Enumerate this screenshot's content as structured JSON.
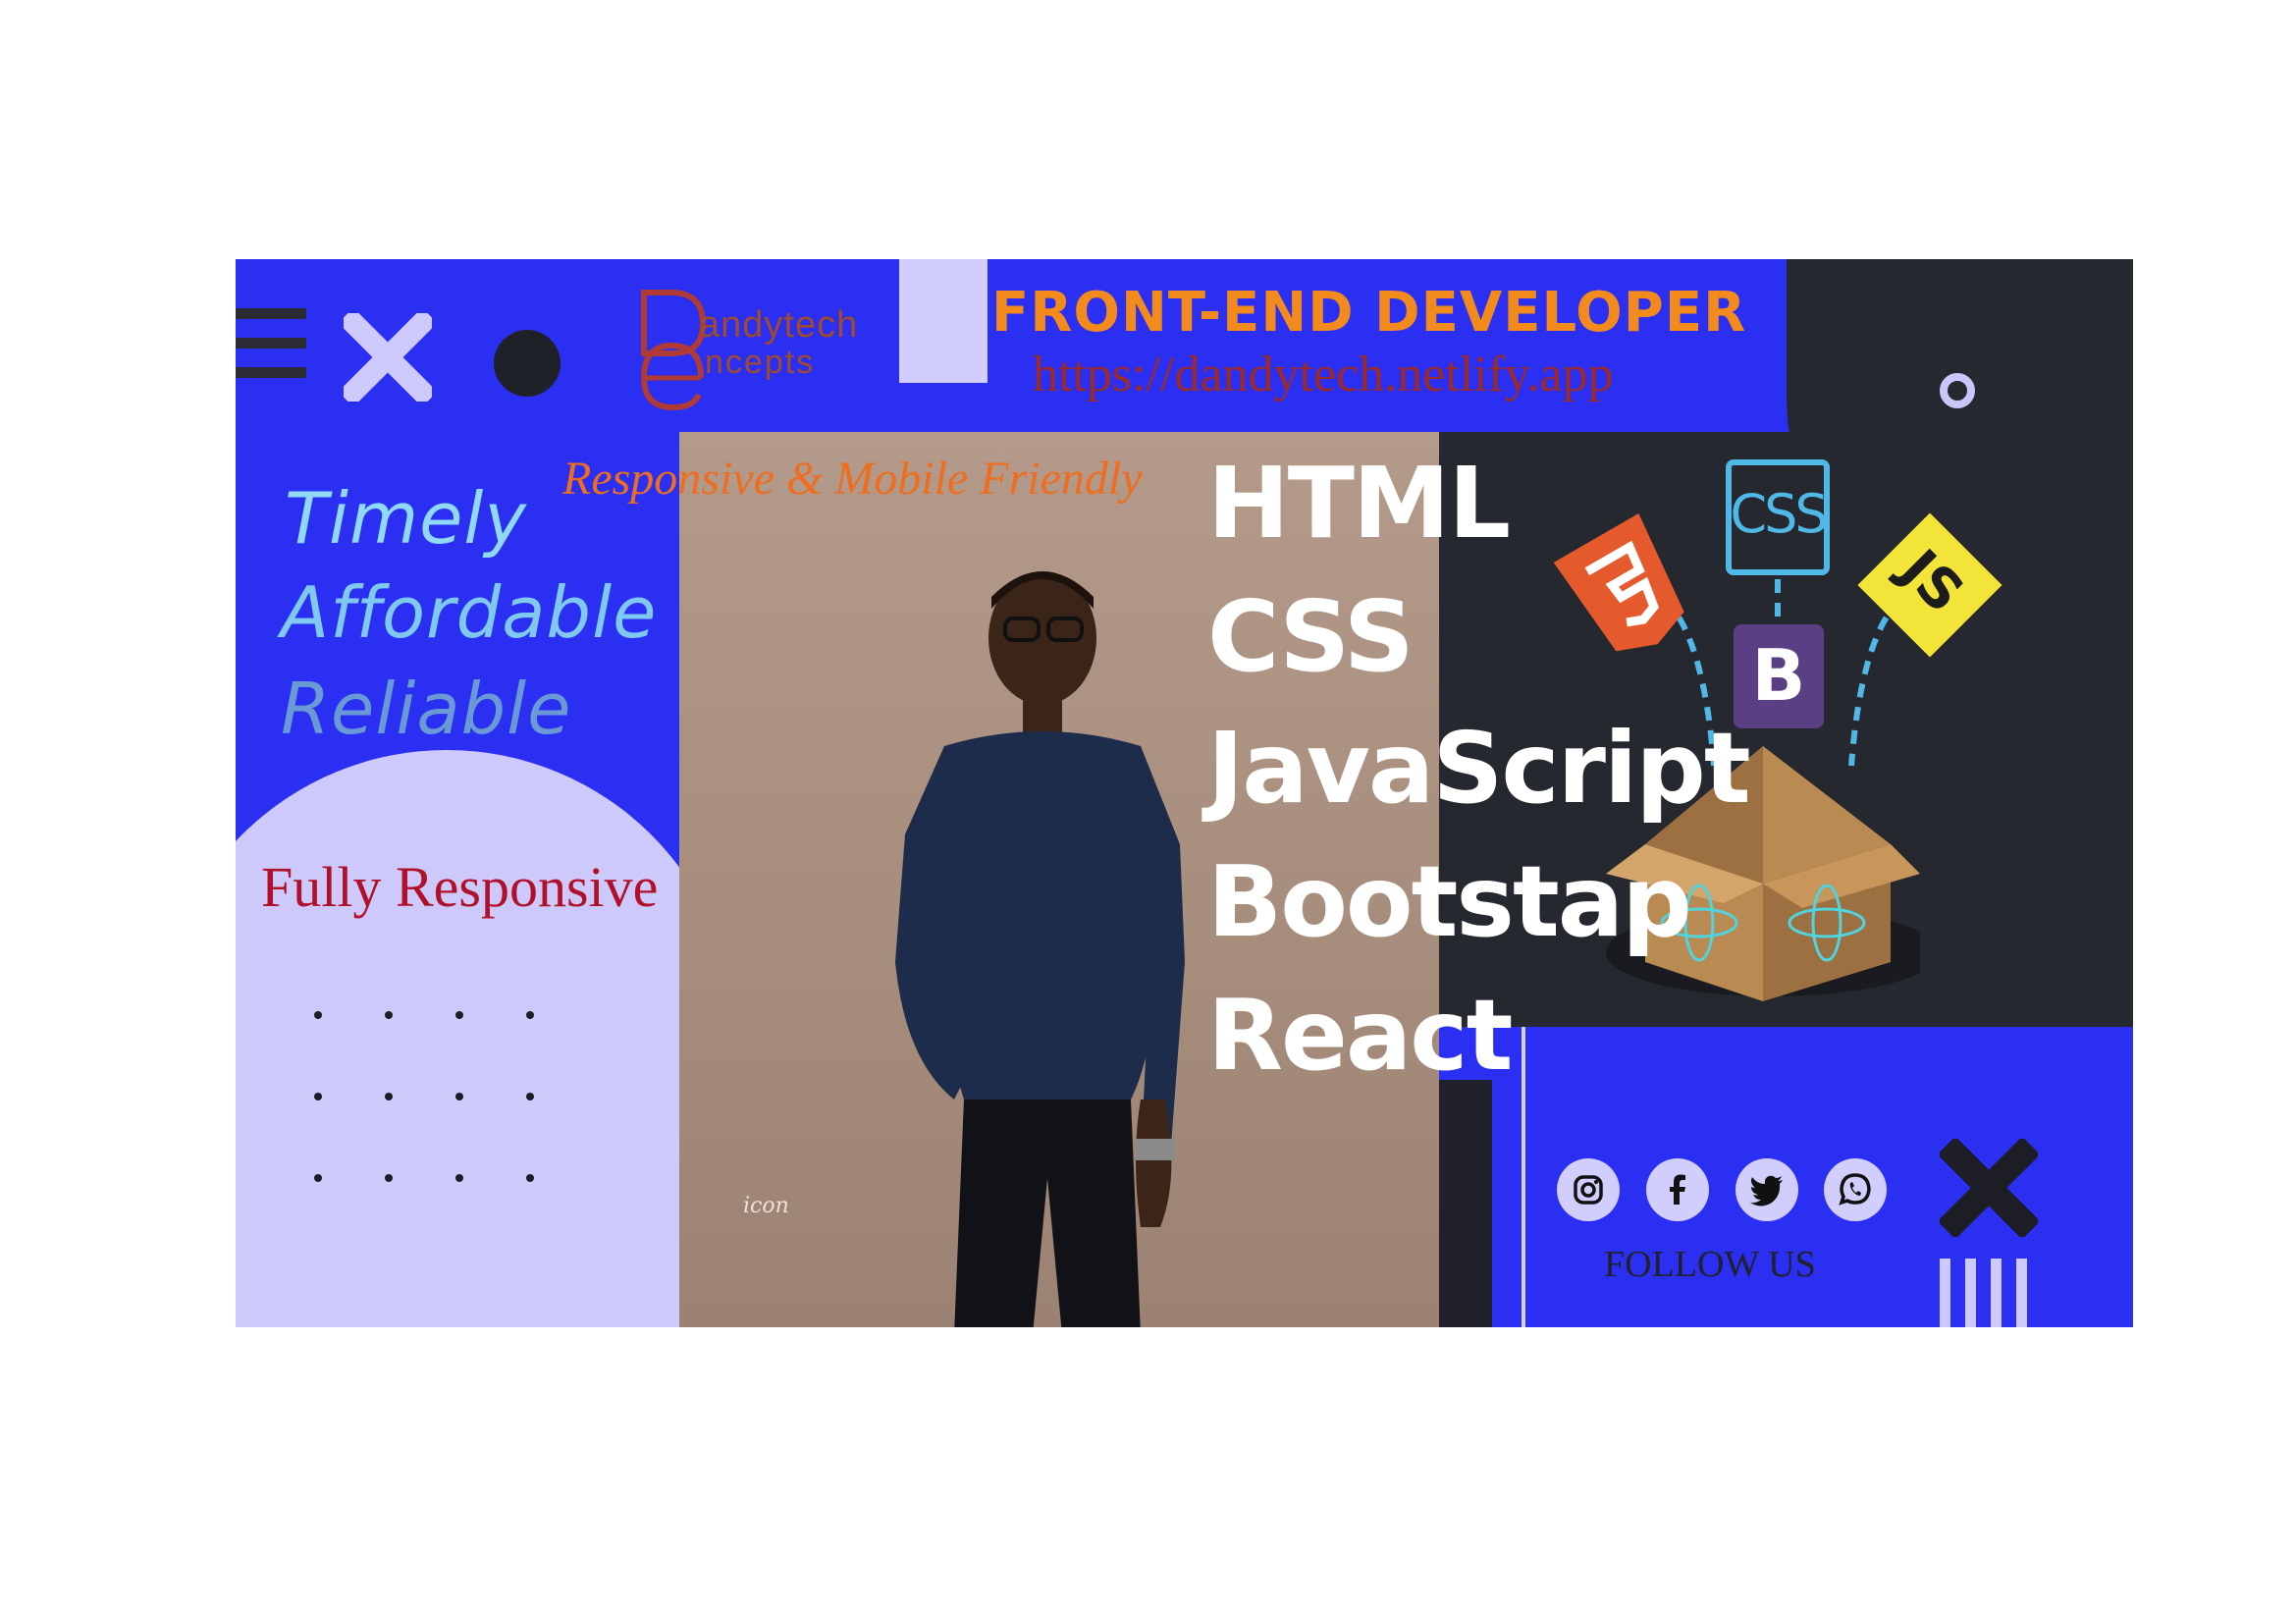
{
  "colors": {
    "brand_blue": "#2a2ff2",
    "lavender": "#cdc9fb",
    "dark": "#262830",
    "orange": "#f28a1c",
    "maroon": "#9c2a28",
    "red": "#b0102a"
  },
  "header": {
    "logo_line1": "andytech",
    "logo_line2": "ncepts",
    "headline": "FRONT-END DEVELOPER",
    "url": "https://dandytech.netlify.app"
  },
  "taglines": [
    "Timely",
    "Affordable",
    "Reliable"
  ],
  "responsive_note": "Responsive & Mobile Friendly",
  "fully_responsive": "Fully Responsive",
  "photo": {
    "signature": "icon"
  },
  "tech_stack": [
    "HTML",
    "CSS",
    "JavaScript",
    "Bootstap",
    "React"
  ],
  "tech_graphic": {
    "labels": {
      "css": "CSS",
      "js": "JS",
      "bootstrap": "B"
    }
  },
  "social": {
    "icons": [
      "instagram-icon",
      "facebook-icon",
      "twitter-icon",
      "whatsapp-icon"
    ],
    "follow_label": "FOLLOW US"
  }
}
